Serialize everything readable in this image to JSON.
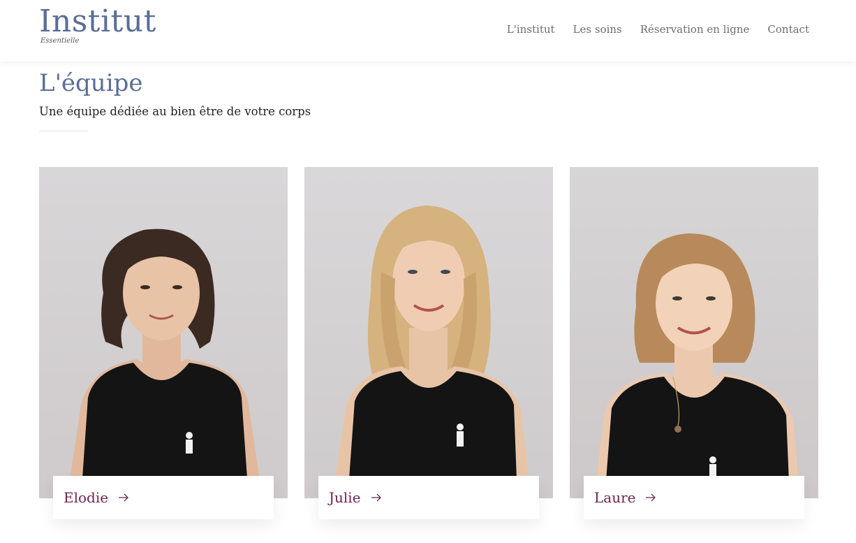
{
  "header": {
    "logo_main": "Institut",
    "logo_sub": "Essentielle",
    "nav": [
      "L'institut",
      "Les soins",
      "Réservation en ligne",
      "Contact"
    ]
  },
  "section": {
    "title": "L'équipe",
    "subtitle": "Une équipe dédiée au bien être de votre corps"
  },
  "team": [
    {
      "name": "Elodie",
      "hair": "#3b2a22",
      "hair_length": "short"
    },
    {
      "name": "Julie",
      "hair": "#d6b27e",
      "hair_length": "long"
    },
    {
      "name": "Laure",
      "hair": "#b8895a",
      "hair_length": "medium"
    }
  ],
  "colors": {
    "accent_blue": "#5a6d96",
    "name_color": "#6a2550",
    "background": "#ffffff"
  },
  "icons": [
    "arrow-right-icon",
    "logo-emblem-icon"
  ]
}
